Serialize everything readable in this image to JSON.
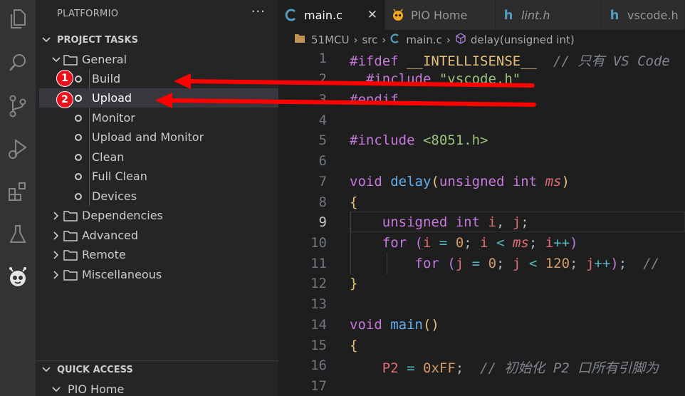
{
  "sidebar": {
    "title": "PLATFORMIO",
    "more_label": "···",
    "project_tasks": "PROJECT TASKS",
    "general": "General",
    "tasks": [
      "Build",
      "Upload",
      "Monitor",
      "Upload and Monitor",
      "Clean",
      "Full Clean",
      "Devices"
    ],
    "folders": [
      "Dependencies",
      "Advanced",
      "Remote",
      "Miscellaneous"
    ],
    "quick_access": "QUICK ACCESS",
    "pio_home": "PIO Home"
  },
  "tabs": [
    {
      "label": "main.c",
      "icon": "C",
      "active": true
    },
    {
      "label": "PIO Home",
      "icon": "pio",
      "active": false
    },
    {
      "label": "lint.h",
      "icon": "h",
      "active": false
    },
    {
      "label": "vscode.h",
      "icon": "h",
      "active": false
    }
  ],
  "close_label": "✕",
  "breadcrumb": {
    "project": "51MCU",
    "folder": "src",
    "file": "main.c",
    "symbol": "delay(unsigned int)"
  },
  "editor": {
    "line_numbers": [
      "1",
      "2",
      "3",
      "4",
      "5",
      "6",
      "7",
      "8",
      "9",
      "10",
      "11",
      "12",
      "13",
      "14",
      "15",
      "16",
      "17"
    ],
    "current_line": "9"
  },
  "annotations": {
    "badge1": "1",
    "badge2": "2"
  },
  "colors": {
    "accent": "#e8111c",
    "c_icon": "#519aba",
    "pio_icon": "#f5a623"
  }
}
